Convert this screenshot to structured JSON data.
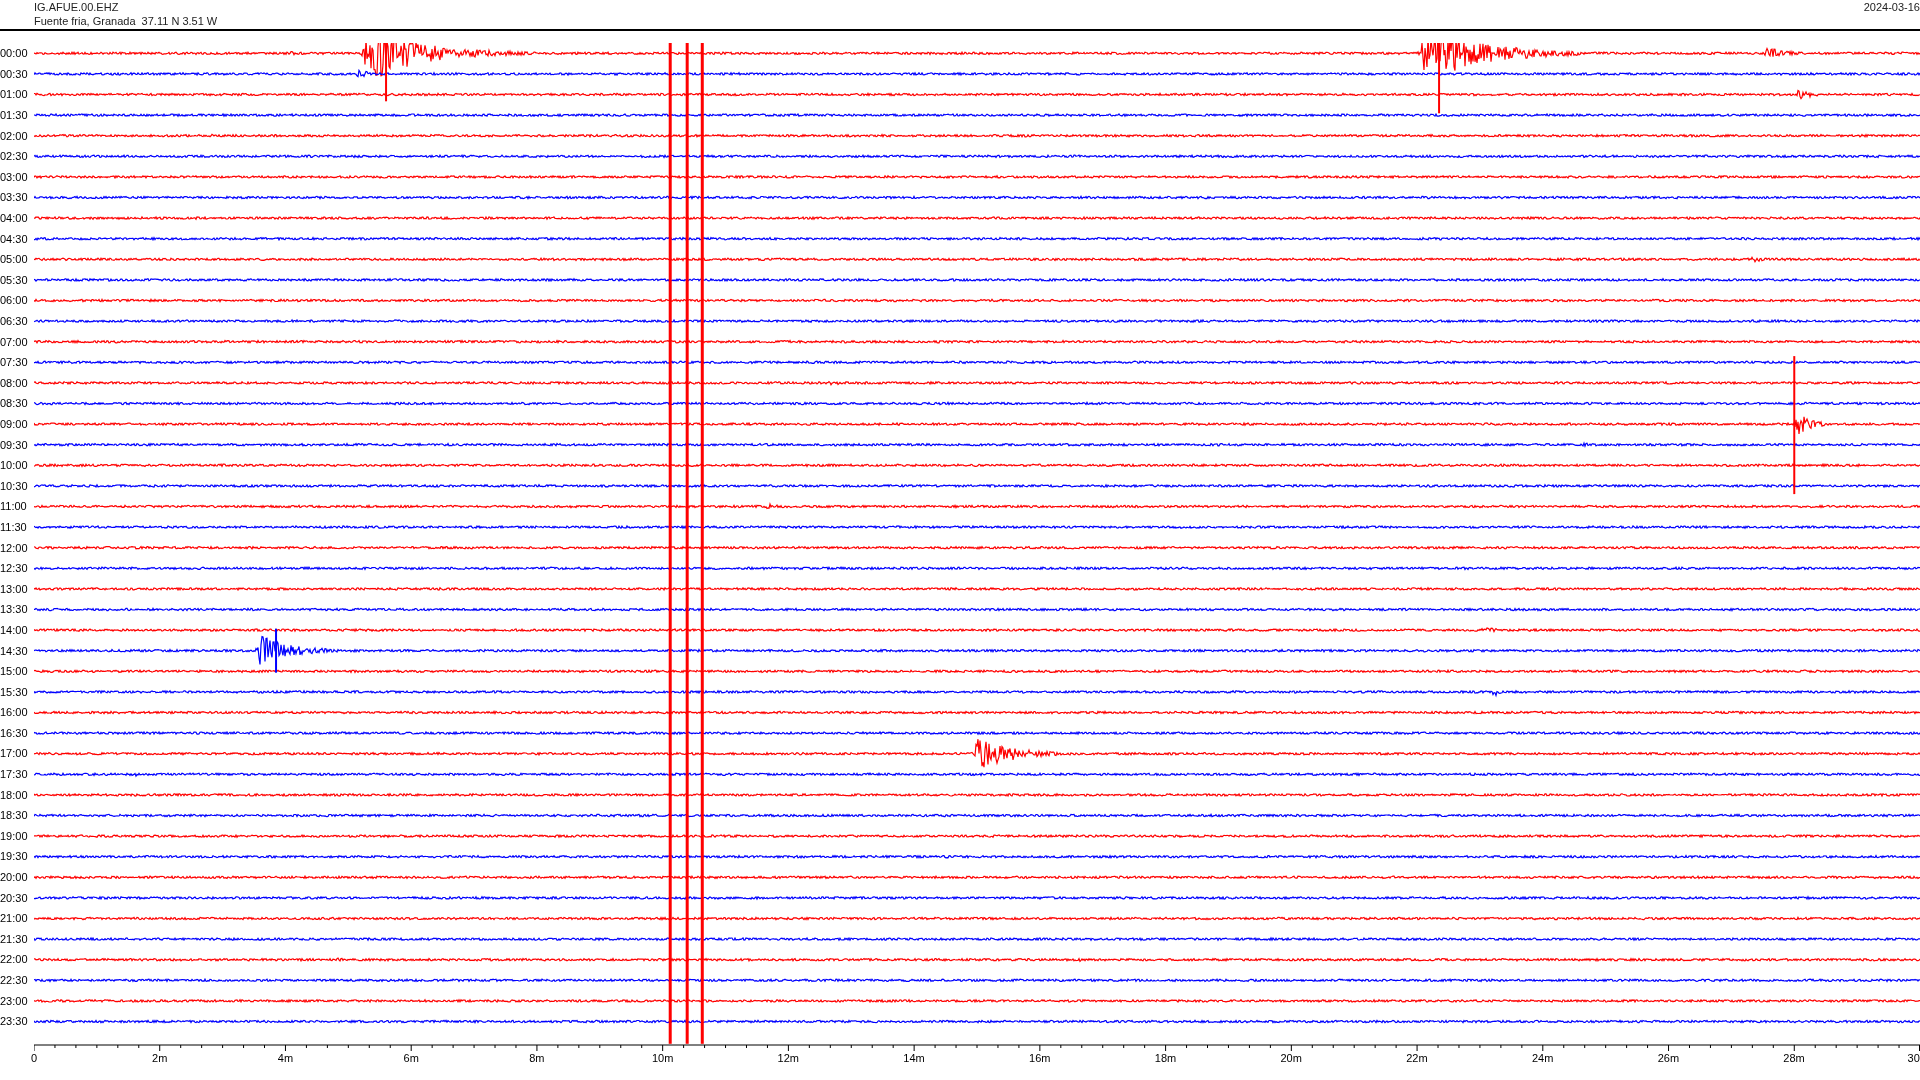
{
  "header": {
    "station": "IG.AFUE.00.EHZ",
    "location": "Fuente fria, Granada  37.11 N 3.51 W",
    "date": "2024-03-16"
  },
  "rows": [
    {
      "label": "00:00",
      "color": "#ff0000"
    },
    {
      "label": "00:30",
      "color": "#0000ff"
    },
    {
      "label": "01:00",
      "color": "#ff0000"
    },
    {
      "label": "01:30",
      "color": "#0000ff"
    },
    {
      "label": "02:00",
      "color": "#ff0000"
    },
    {
      "label": "02:30",
      "color": "#0000ff"
    },
    {
      "label": "03:00",
      "color": "#ff0000"
    },
    {
      "label": "03:30",
      "color": "#0000ff"
    },
    {
      "label": "04:00",
      "color": "#ff0000"
    },
    {
      "label": "04:30",
      "color": "#0000ff"
    },
    {
      "label": "05:00",
      "color": "#ff0000"
    },
    {
      "label": "05:30",
      "color": "#0000ff"
    },
    {
      "label": "06:00",
      "color": "#ff0000"
    },
    {
      "label": "06:30",
      "color": "#0000ff"
    },
    {
      "label": "07:00",
      "color": "#ff0000"
    },
    {
      "label": "07:30",
      "color": "#0000ff"
    },
    {
      "label": "08:00",
      "color": "#ff0000"
    },
    {
      "label": "08:30",
      "color": "#0000ff"
    },
    {
      "label": "09:00",
      "color": "#ff0000"
    },
    {
      "label": "09:30",
      "color": "#0000ff"
    },
    {
      "label": "10:00",
      "color": "#ff0000"
    },
    {
      "label": "10:30",
      "color": "#0000ff"
    },
    {
      "label": "11:00",
      "color": "#ff0000"
    },
    {
      "label": "11:30",
      "color": "#0000ff"
    },
    {
      "label": "12:00",
      "color": "#ff0000"
    },
    {
      "label": "12:30",
      "color": "#0000ff"
    },
    {
      "label": "13:00",
      "color": "#ff0000"
    },
    {
      "label": "13:30",
      "color": "#0000ff"
    },
    {
      "label": "14:00",
      "color": "#ff0000"
    },
    {
      "label": "14:30",
      "color": "#0000ff"
    },
    {
      "label": "15:00",
      "color": "#ff0000"
    },
    {
      "label": "15:30",
      "color": "#0000ff"
    },
    {
      "label": "16:00",
      "color": "#ff0000"
    },
    {
      "label": "16:30",
      "color": "#0000ff"
    },
    {
      "label": "17:00",
      "color": "#ff0000"
    },
    {
      "label": "17:30",
      "color": "#0000ff"
    },
    {
      "label": "18:00",
      "color": "#ff0000"
    },
    {
      "label": "18:30",
      "color": "#0000ff"
    },
    {
      "label": "19:00",
      "color": "#ff0000"
    },
    {
      "label": "19:30",
      "color": "#0000ff"
    },
    {
      "label": "20:00",
      "color": "#ff0000"
    },
    {
      "label": "20:30",
      "color": "#0000ff"
    },
    {
      "label": "21:00",
      "color": "#ff0000"
    },
    {
      "label": "21:30",
      "color": "#0000ff"
    },
    {
      "label": "22:00",
      "color": "#ff0000"
    },
    {
      "label": "22:30",
      "color": "#0000ff"
    },
    {
      "label": "23:00",
      "color": "#ff0000"
    },
    {
      "label": "23:30",
      "color": "#0000ff"
    }
  ],
  "axis": {
    "ticks": [
      "0",
      "2m",
      "4m",
      "6m",
      "8m",
      "10m",
      "12m",
      "14m",
      "16m",
      "18m",
      "20m",
      "22m",
      "24m",
      "26m",
      "28m",
      "30"
    ]
  }
}
